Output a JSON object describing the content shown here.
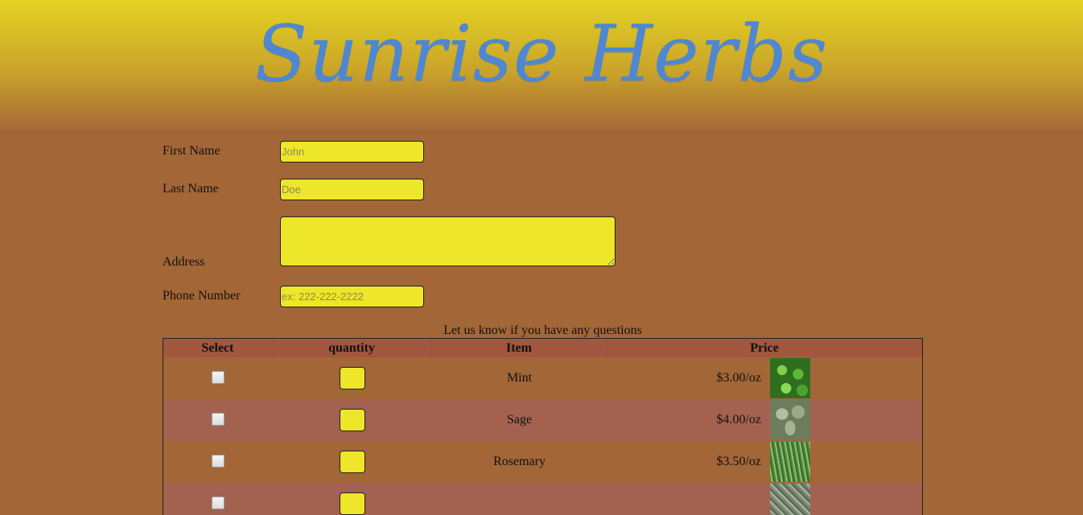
{
  "header": {
    "title": "Sunrise Herbs",
    "gradient_top": "#e3d322",
    "title_color": "#4f87d0"
  },
  "form": {
    "first_name": {
      "label": "First Name",
      "placeholder": "John",
      "value": ""
    },
    "last_name": {
      "label": "Last Name",
      "placeholder": "Doe",
      "value": ""
    },
    "address": {
      "label": "Address",
      "value": ""
    },
    "phone": {
      "label": "Phone Number",
      "placeholder": "ex: 222-222-2222",
      "value": ""
    },
    "questions_text": "Let us know if you have any questions"
  },
  "table": {
    "headers": {
      "select": "Select",
      "quantity": "quantity",
      "item": "Item",
      "price": "Price"
    },
    "rows": [
      {
        "item": "Mint",
        "price": "$3.00/oz",
        "checked": false,
        "quantity": "",
        "icon": "mint-image"
      },
      {
        "item": "Sage",
        "price": "$4.00/oz",
        "checked": false,
        "quantity": "",
        "icon": "sage-image"
      },
      {
        "item": "Rosemary",
        "price": "$3.50/oz",
        "checked": false,
        "quantity": "",
        "icon": "rosemary-image"
      },
      {
        "item": "",
        "price": "",
        "checked": false,
        "quantity": "",
        "icon": "thyme-image"
      }
    ]
  },
  "colors": {
    "page_background": "#a36637",
    "input_background": "#ede629"
  }
}
